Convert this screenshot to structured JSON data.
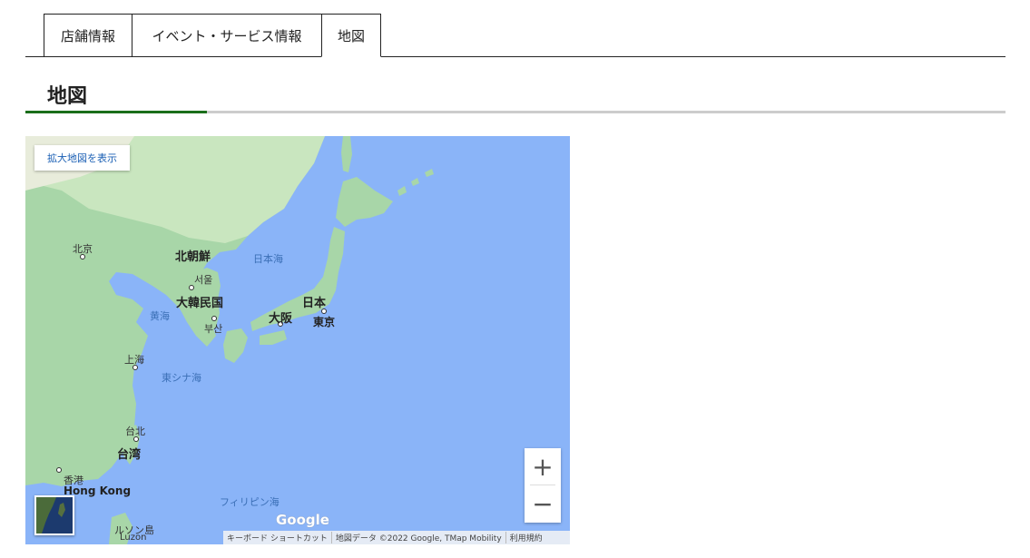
{
  "tabs": [
    {
      "label": "店舗情報"
    },
    {
      "label": "イベント・サービス情報"
    },
    {
      "label": "地図"
    }
  ],
  "section": {
    "title": "地図"
  },
  "map": {
    "enlarge_label": "拡大地図を表示",
    "labels": {
      "beijing": "北京",
      "north_korea": "北朝鮮",
      "sea_of_japan": "日本海",
      "seoul": "서울",
      "south_korea": "大韓民国",
      "yellow_sea": "黄海",
      "busan": "부산",
      "japan": "日本",
      "osaka": "大阪",
      "tokyo": "東京",
      "shanghai": "上海",
      "east_china_sea": "東シナ海",
      "taipei": "台北",
      "taiwan": "台湾",
      "hongkong_jp": "香港",
      "hongkong_en": "Hong Kong",
      "philippine_sea": "フィリピン海",
      "luzon_jp": "ルソン島",
      "luzon_en": "Luzon"
    },
    "zoom_in": "+",
    "zoom_out": "−",
    "google_logo": "Google",
    "attribution": {
      "shortcuts": "キーボード ショートカット",
      "data": "地図データ ©2022 Google, TMap Mobility",
      "terms": "利用規約"
    }
  }
}
